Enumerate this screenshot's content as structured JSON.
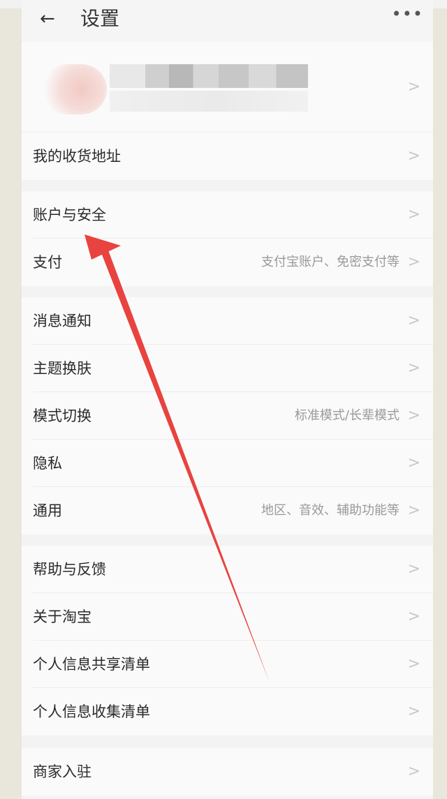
{
  "nav": {
    "back_icon": "←",
    "title": "设置",
    "more_icon": "•••"
  },
  "profile": {
    "chevron": ">"
  },
  "groups": {
    "address": {
      "label": "我的收货地址",
      "chevron": ">"
    },
    "account": {
      "items": [
        {
          "label": "账户与安全",
          "value": "",
          "chevron": ">"
        },
        {
          "label": "支付",
          "value": "支付宝账户、免密支付等",
          "chevron": ">"
        }
      ]
    },
    "prefs": {
      "items": [
        {
          "label": "消息通知",
          "value": "",
          "chevron": ">"
        },
        {
          "label": "主题换肤",
          "value": "",
          "chevron": ">"
        },
        {
          "label": "模式切换",
          "value": "标准模式/长辈模式",
          "chevron": ">"
        },
        {
          "label": "隐私",
          "value": "",
          "chevron": ">"
        },
        {
          "label": "通用",
          "value": "地区、音效、辅助功能等",
          "chevron": ">"
        }
      ]
    },
    "help": {
      "items": [
        {
          "label": "帮助与反馈",
          "value": "",
          "chevron": ">"
        },
        {
          "label": "关于淘宝",
          "value": "",
          "chevron": ">"
        },
        {
          "label": "个人信息共享清单",
          "value": "",
          "chevron": ">"
        },
        {
          "label": "个人信息收集清单",
          "value": "",
          "chevron": ">"
        }
      ]
    },
    "merchant": {
      "label": "商家入驻",
      "chevron": ">"
    }
  },
  "annotation": {
    "arrow_color": "#e8433f"
  }
}
